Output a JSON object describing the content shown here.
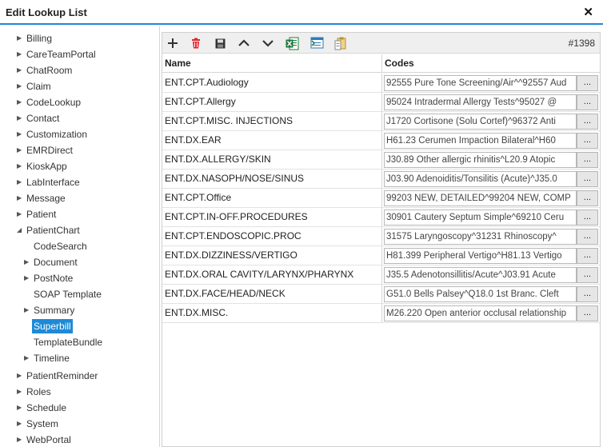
{
  "window": {
    "title": "Edit Lookup List",
    "close_glyph": "✕"
  },
  "tree": {
    "items": [
      {
        "label": "Billing",
        "arrow": "▶",
        "level": 0
      },
      {
        "label": "CareTeamPortal",
        "arrow": "▶",
        "level": 0
      },
      {
        "label": "ChatRoom",
        "arrow": "▶",
        "level": 0
      },
      {
        "label": "Claim",
        "arrow": "▶",
        "level": 0
      },
      {
        "label": "CodeLookup",
        "arrow": "▶",
        "level": 0
      },
      {
        "label": "Contact",
        "arrow": "▶",
        "level": 0
      },
      {
        "label": "Customization",
        "arrow": "▶",
        "level": 0
      },
      {
        "label": "EMRDirect",
        "arrow": "▶",
        "level": 0
      },
      {
        "label": "KioskApp",
        "arrow": "▶",
        "level": 0
      },
      {
        "label": "LabInterface",
        "arrow": "▶",
        "level": 0
      },
      {
        "label": "Message",
        "arrow": "▶",
        "level": 0
      },
      {
        "label": "Patient",
        "arrow": "▶",
        "level": 0
      },
      {
        "label": "PatientChart",
        "arrow": "◢",
        "level": 0
      },
      {
        "label": "CodeSearch",
        "arrow": "",
        "level": 1
      },
      {
        "label": "Document",
        "arrow": "▶",
        "level": 1
      },
      {
        "label": "PostNote",
        "arrow": "▶",
        "level": 1
      },
      {
        "label": "SOAP Template",
        "arrow": "",
        "level": 1
      },
      {
        "label": "Summary",
        "arrow": "▶",
        "level": 1
      },
      {
        "label": "Superbill",
        "arrow": "",
        "level": 1,
        "selected": true
      },
      {
        "label": "TemplateBundle",
        "arrow": "",
        "level": 1
      },
      {
        "label": "Timeline",
        "arrow": "▶",
        "level": 1
      },
      {
        "label": "PatientReminder",
        "arrow": "▶",
        "level": 0
      },
      {
        "label": "Roles",
        "arrow": "▶",
        "level": 0
      },
      {
        "label": "Schedule",
        "arrow": "▶",
        "level": 0
      },
      {
        "label": "System",
        "arrow": "▶",
        "level": 0
      },
      {
        "label": "WebPortal",
        "arrow": "▶",
        "level": 0
      }
    ]
  },
  "toolbar": {
    "record_id": "#1398",
    "icons": [
      "add-icon",
      "delete-icon",
      "save-icon",
      "move-up-icon",
      "move-down-icon",
      "excel-export-icon",
      "import-icon",
      "clipboard-icon"
    ]
  },
  "grid": {
    "columns": {
      "name": "Name",
      "codes": "Codes"
    },
    "ellipsis_label": "...",
    "rows": [
      {
        "name": "ENT.CPT.Audiology",
        "codes": "92555 Pure Tone Screening/Air^^92557 Aud"
      },
      {
        "name": "ENT.CPT.Allergy",
        "codes": "95024 Intradermal Allergy Tests^95027 @"
      },
      {
        "name": "ENT.CPT.MISC. INJECTIONS",
        "codes": "J1720 Cortisone (Solu Cortef)^96372 Anti"
      },
      {
        "name": "ENT.DX.EAR",
        "codes": "H61.23 Cerumen Impaction Bilateral^H60"
      },
      {
        "name": "ENT.DX.ALLERGY/SKIN",
        "codes": "J30.89 Other allergic rhinitis^L20.9 Atopic"
      },
      {
        "name": "ENT.DX.NASOPH/NOSE/SINUS",
        "codes": "J03.90 Adenoiditis/Tonsilitis (Acute)^J35.0"
      },
      {
        "name": "ENT.CPT.Office",
        "codes": "99203 NEW, DETAILED^99204 NEW, COMP"
      },
      {
        "name": "ENT.CPT.IN-OFF.PROCEDURES",
        "codes": "30901 Cautery Septum Simple^69210 Ceru"
      },
      {
        "name": "ENT.CPT.ENDOSCOPIC.PROC",
        "codes": "31575 Laryngoscopy^31231 Rhinoscopy^"
      },
      {
        "name": "ENT.DX.DIZZINESS/VERTIGO",
        "codes": "H81.399 Peripheral Vertigo^H81.13 Vertigo"
      },
      {
        "name": "ENT.DX.ORAL CAVITY/LARYNX/PHARYNX",
        "codes": "J35.5 Adenotonsillitis/Acute^J03.91 Acute"
      },
      {
        "name": "ENT.DX.FACE/HEAD/NECK",
        "codes": "G51.0 Bells Palsey^Q18.0 1st Branc. Cleft"
      },
      {
        "name": "ENT.DX.MISC.",
        "codes": "M26.220 Open anterior occlusal relationship"
      }
    ]
  },
  "colors": {
    "accent": "#1e8ad6",
    "delete": "#e0262b",
    "excel": "#1f7a3d"
  }
}
